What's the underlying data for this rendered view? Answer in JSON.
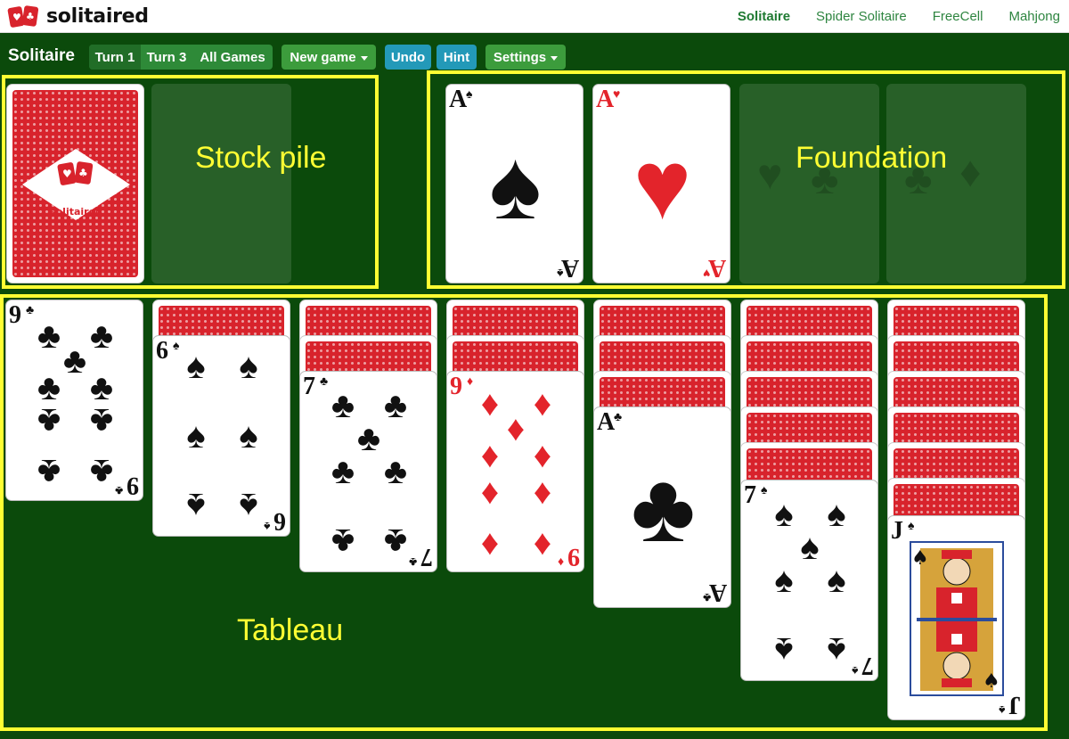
{
  "nav": {
    "brand": "solitaired",
    "links": [
      "Solitaire",
      "Spider Solitaire",
      "FreeCell",
      "Mahjong"
    ],
    "active": "Solitaire"
  },
  "toolbar": {
    "title": "Solitaire",
    "turn1": "Turn 1",
    "turn3": "Turn 3",
    "all_games": "All Games",
    "new_game": "New game",
    "undo": "Undo",
    "hint": "Hint",
    "settings": "Settings"
  },
  "annotations": {
    "stock": "Stock pile",
    "foundation": "Foundation",
    "tableau": "Tableau"
  },
  "stock_back_brand": "solitaired",
  "foundation": [
    {
      "rank": "A",
      "suit": "♠",
      "color": "black"
    },
    {
      "rank": "A",
      "suit": "♥",
      "color": "red"
    }
  ],
  "tableau": [
    {
      "face_down": 0,
      "rank": "9",
      "suit": "♣",
      "color": "black"
    },
    {
      "face_down": 1,
      "rank": "6",
      "suit": "♠",
      "color": "black"
    },
    {
      "face_down": 2,
      "rank": "7",
      "suit": "♣",
      "color": "black"
    },
    {
      "face_down": 2,
      "rank": "9",
      "suit": "♦",
      "color": "red"
    },
    {
      "face_down": 3,
      "rank": "A",
      "suit": "♣",
      "color": "black"
    },
    {
      "face_down": 5,
      "rank": "7",
      "suit": "♠",
      "color": "black"
    },
    {
      "face_down": 6,
      "rank": "J",
      "suit": "♠",
      "color": "black"
    }
  ],
  "colors": {
    "felt": "#0b4a0b",
    "highlight": "#ffff33",
    "card_back": "#d8232c",
    "nav_link": "#2e8540"
  }
}
